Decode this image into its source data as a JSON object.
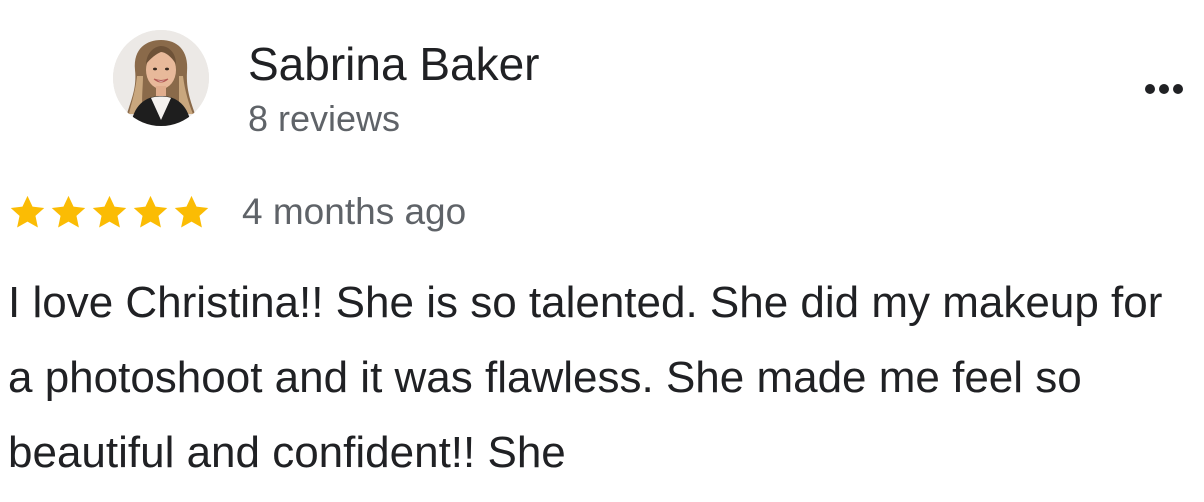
{
  "reviewer": {
    "name": "Sabrina Baker",
    "review_count": "8 reviews",
    "avatar_icon": "profile-photo"
  },
  "menu": {
    "icon": "more-horizontal-icon"
  },
  "rating": {
    "stars": 5,
    "max_stars": 5,
    "star_color": "#fbbc04",
    "time": "4 months ago"
  },
  "review": {
    "text": "I love Christina!! She is so talented. She did my makeup for a photoshoot and it was flawless. She made me feel so beautiful and confident!! She"
  },
  "colors": {
    "primary_text": "#202124",
    "secondary_text": "#5f6368"
  }
}
